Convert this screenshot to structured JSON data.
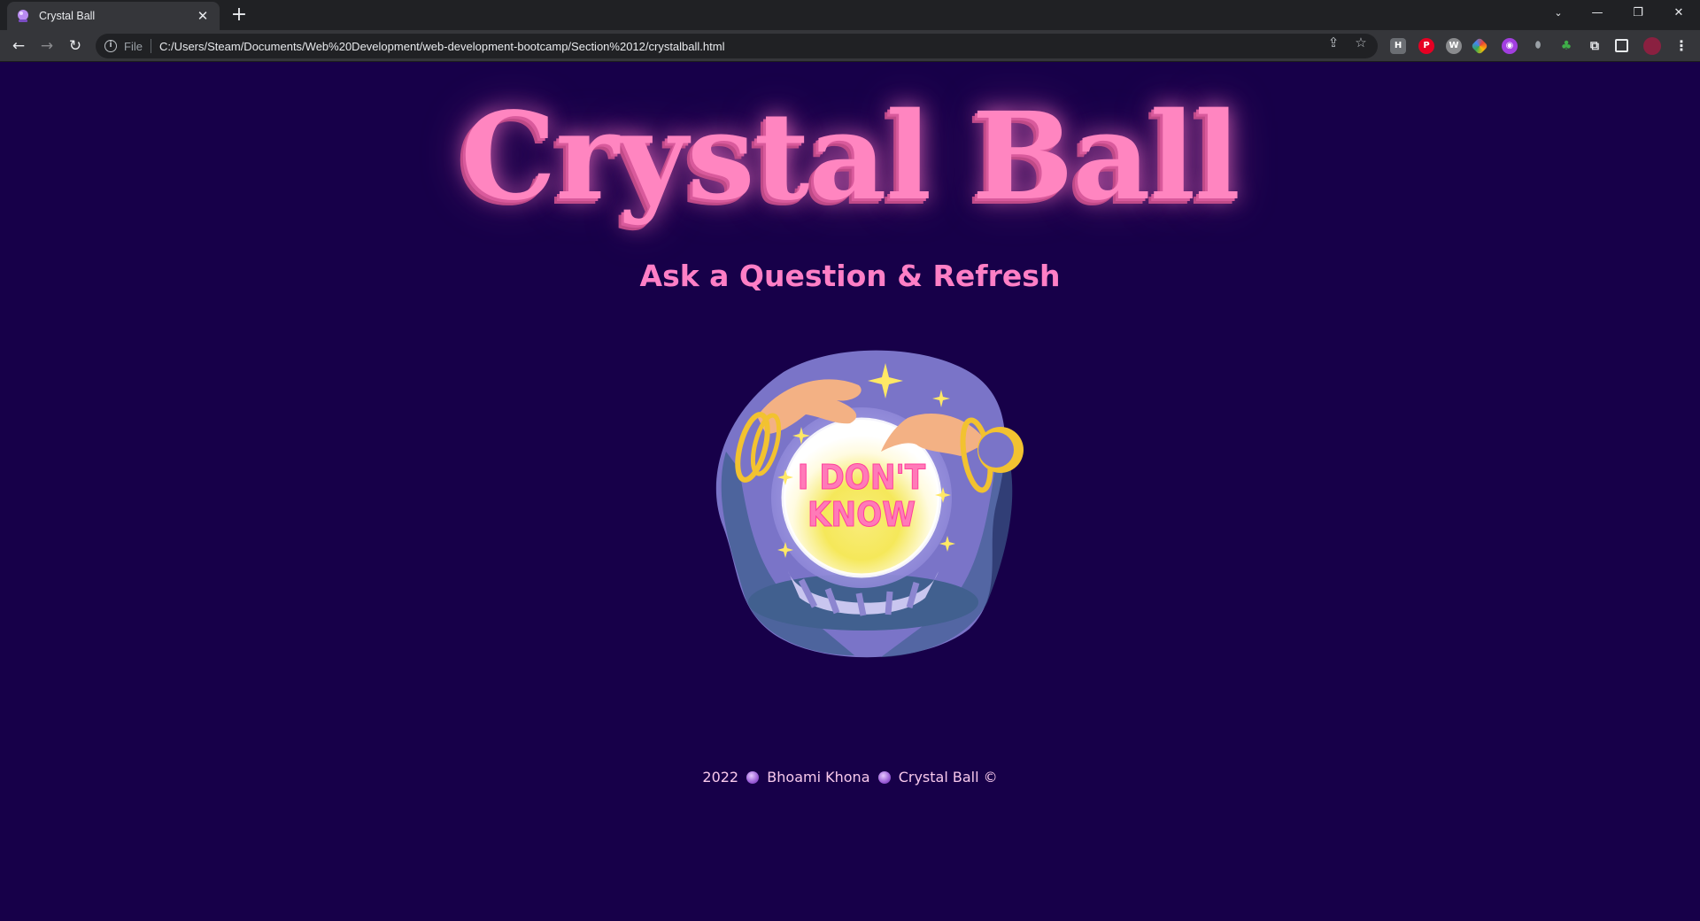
{
  "browser": {
    "tab_title": "Crystal Ball",
    "address_scheme": "File",
    "address_url": "C:/Users/Steam/Documents/Web%20Development/web-development-bootcamp/Section%2012/crystalball.html"
  },
  "page": {
    "heading": "Crystal Ball",
    "subtitle": "Ask a Question & Refresh",
    "image": {
      "caption_line1": "I DON'T",
      "caption_line2": "KNOW",
      "subject": "crystal-ball-illustration"
    },
    "footer": {
      "year": "2022",
      "author": "Bhoami Khona",
      "site": "Crystal Ball ©"
    }
  },
  "colors": {
    "background": "#170049",
    "heading": "#ff85c0",
    "subtitle": "#ff7fc6",
    "footer_text": "#f8c9ec"
  }
}
